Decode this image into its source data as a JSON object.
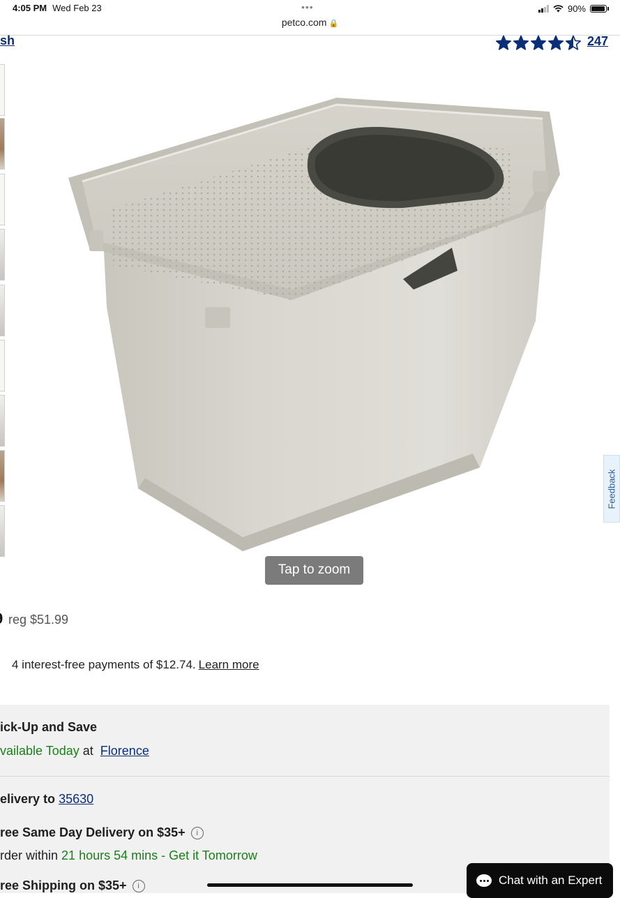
{
  "status_bar": {
    "time": "4:05 PM",
    "date": "Wed Feb 23",
    "dots": "•••",
    "url": "petco.com",
    "battery": "90%",
    "signal_bars": 2,
    "signal_total": 4
  },
  "product": {
    "brand_link": "sh",
    "rating": 4.5,
    "rating_max": 5,
    "review_count": "247",
    "thumbnail_count": 9,
    "zoom_label": "Tap to zoom",
    "image_description_icon": "covered-top-entry-litter-box"
  },
  "feedback_label": "Feedback",
  "pricing": {
    "sale_price_fragment": "9",
    "reg_price": "reg $51.99",
    "installments_text": "4 interest-free payments of $12.74.",
    "learn_more": "Learn more"
  },
  "fulfillment": {
    "pickup_title": "ick-Up and Save",
    "pickup_status": "vailable Today",
    "pickup_at": "at",
    "pickup_store": "Florence",
    "delivery_to_label": "elivery to",
    "delivery_zip": "35630",
    "same_day_label": "ree Same Day Delivery on $35+",
    "order_within_prefix": "rder within",
    "order_within_time": "21 hours 54 mins - Get it Tomorrow",
    "free_shipping_label": "ree Shipping on $35+"
  },
  "chat": {
    "label": "Chat with an Expert"
  },
  "colors": {
    "link_blue": "#0a2f78",
    "success_green": "#1a7f1a",
    "panel_bg": "#f1f1f1"
  }
}
